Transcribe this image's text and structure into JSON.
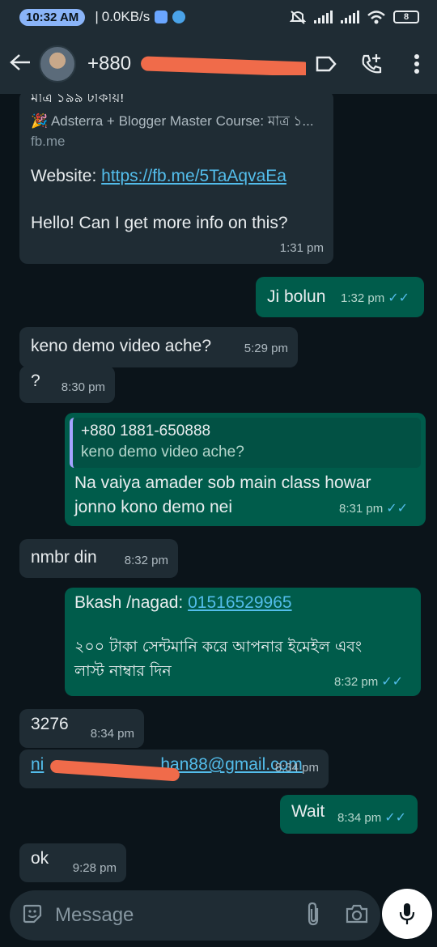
{
  "status_bar": {
    "time": "10:32 AM",
    "separator": "|",
    "net_speed": "0.0KB/s",
    "battery": "8"
  },
  "header": {
    "contact_prefix": "+880"
  },
  "messages": [
    {
      "type": "in",
      "preview_top": "মাত্র ১৯৯ টাকায়!",
      "preview_title": "🎉 Adsterra + Blogger Master Course: মাত্র ১...",
      "preview_domain": "fb.me",
      "website_label": "Website: ",
      "website_link": "https://fb.me/5TaAqvaEa",
      "text": "Hello! Can I get more info on this?",
      "time": "1:31 pm"
    },
    {
      "type": "out",
      "text": "Ji bolun",
      "time": "1:32 pm"
    },
    {
      "type": "in",
      "text": "keno demo video ache?",
      "time": "5:29 pm"
    },
    {
      "type": "in",
      "text": "?",
      "time": "8:30 pm"
    },
    {
      "type": "out",
      "quote_name": "+880 1881-650888",
      "quote_text": "keno demo video ache?",
      "text": "Na vaiya amader sob main class howar jonno kono demo nei",
      "time": "8:31 pm"
    },
    {
      "type": "in",
      "text": "nmbr din",
      "time": "8:32 pm"
    },
    {
      "type": "out",
      "text_label": "Bkash /nagad: ",
      "text_link": "01516529965",
      "text2": "২০০ টাকা সেন্টমানি করে আপনার ইমেইল এবং লাস্ট নাম্বার দিন",
      "time": "8:32 pm"
    },
    {
      "type": "in",
      "text": "3276",
      "time": "8:34 pm"
    },
    {
      "type": "in",
      "link_start": "ni",
      "link_end": "han88@gmail.com",
      "time": "8:34 pm"
    },
    {
      "type": "out",
      "text": "Wait",
      "time": "8:34 pm"
    },
    {
      "type": "in",
      "text": "ok",
      "time": "9:28 pm"
    }
  ],
  "input": {
    "placeholder": "Message"
  },
  "ticks": "✓✓",
  "colors": {
    "incoming": "#1f2c34",
    "outgoing": "#005c4b",
    "link": "#53bdeb",
    "background": "#0b141a"
  }
}
